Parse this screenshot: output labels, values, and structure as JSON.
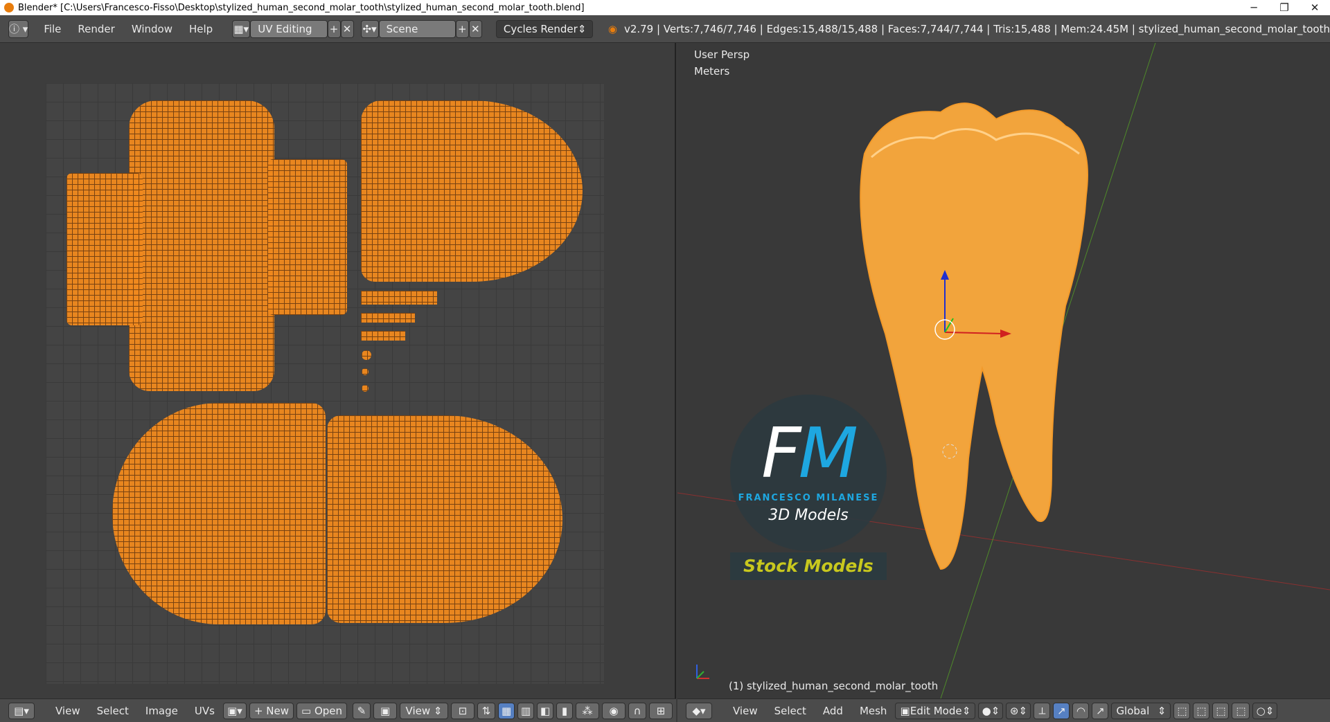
{
  "window": {
    "title": "Blender* [C:\\Users\\Francesco-Fisso\\Desktop\\stylized_human_second_molar_tooth\\stylized_human_second_molar_tooth.blend]",
    "minimize": "─",
    "restore": "❐",
    "close": "✕"
  },
  "infobar": {
    "menus": [
      "File",
      "Render",
      "Window",
      "Help"
    ],
    "screen_layout": "UV Editing",
    "scene": "Scene",
    "render_engine": "Cycles Render",
    "stats": "v2.79 | Verts:7,746/7,746 | Edges:15,488/15,488 | Faces:7,744/7,744 | Tris:15,488 | Mem:24.45M | stylized_human_second_molar_tooth"
  },
  "viewport": {
    "view_name": "User Persp",
    "units": "Meters",
    "object_label": "(1) stylized_human_second_molar_tooth"
  },
  "logo": {
    "letters_f": "F",
    "letters_m": "M",
    "name": "FRANCESCO MILANESE",
    "subtitle": "3D Models",
    "stock": "Stock Models"
  },
  "uv_bottom": {
    "menus": [
      "View",
      "Select",
      "Image",
      "UVs"
    ],
    "new_label": "New",
    "open_label": "Open",
    "view_label": "View"
  },
  "view_bottom": {
    "menus": [
      "View",
      "Select",
      "Add",
      "Mesh"
    ],
    "mode": "Edit Mode",
    "orientation": "Global"
  },
  "colors": {
    "uv_orange": "#f18a1e",
    "tooth_orange": "#f2a43c",
    "active_blue": "#5680c2"
  }
}
